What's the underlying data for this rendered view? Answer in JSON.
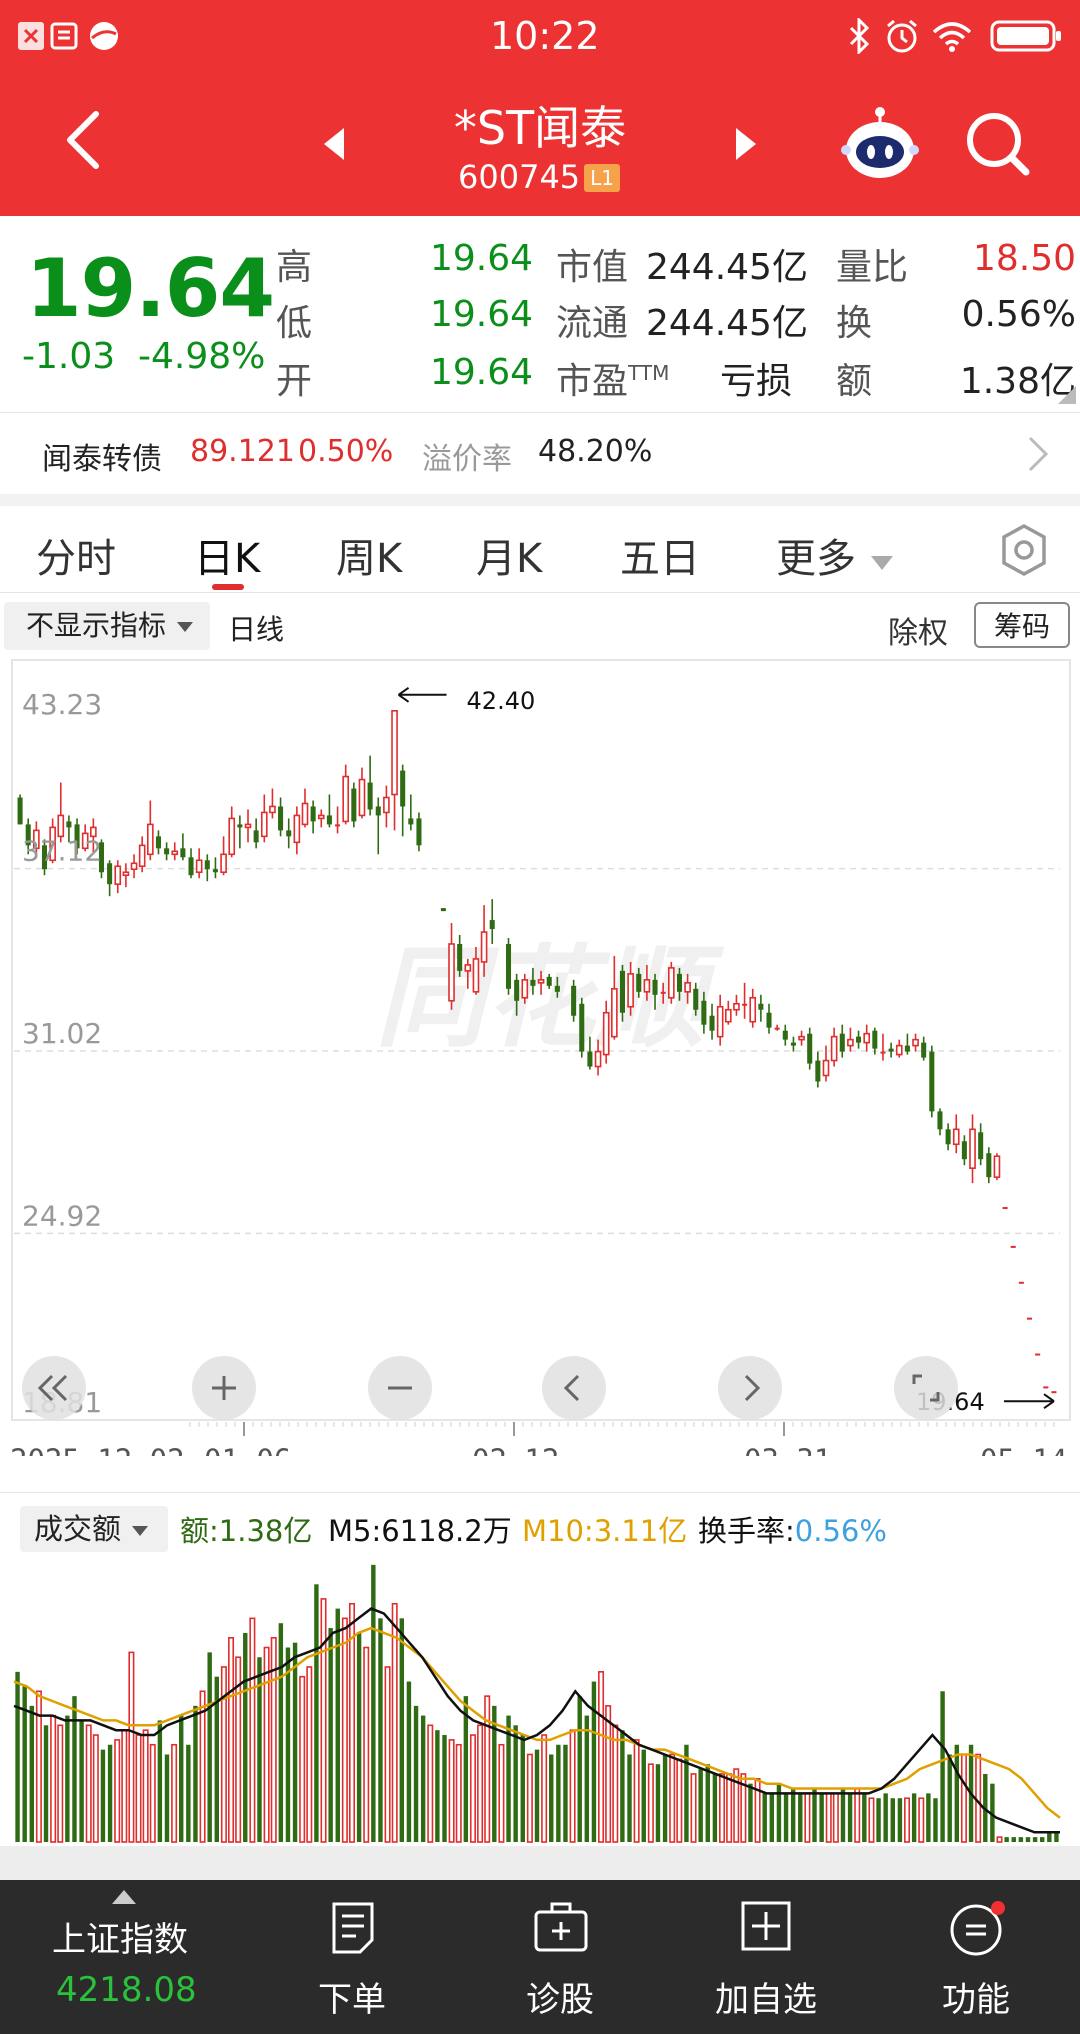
{
  "status": {
    "time": "10:22"
  },
  "header": {
    "title": "*ST闻泰",
    "code": "600745",
    "badge": "L1"
  },
  "quote": {
    "price": "19.64",
    "change": "-1.03",
    "change_pct": "-4.98%",
    "high_label": "高",
    "high": "19.64",
    "low_label": "低",
    "low": "19.64",
    "open_label": "开",
    "open": "19.64",
    "mktcap_label": "市值",
    "mktcap": "244.45亿",
    "float_label": "流通",
    "float": "244.45亿",
    "pe_label": "市盈",
    "pe_sup": "TTM",
    "pe": "亏损",
    "volratio_label": "量比",
    "volratio": "18.50",
    "turnover_label": "换",
    "turnover": "0.56%",
    "amount_label": "额",
    "amount": "1.38亿"
  },
  "bond": {
    "name": "闻泰转债",
    "price": "89.121",
    "pct": "0.50%",
    "premium_label": "溢价率",
    "premium": "48.20%"
  },
  "tabs": [
    {
      "label": "分时"
    },
    {
      "label": "日K"
    },
    {
      "label": "周K"
    },
    {
      "label": "月K"
    },
    {
      "label": "五日"
    },
    {
      "label": "更多"
    }
  ],
  "chart_toolbar": {
    "indicator": "不显示指标",
    "line_type": "日线",
    "exright": "除权",
    "chips": "筹码"
  },
  "colors": {
    "up": "#e02d2d",
    "down": "#2e6b12",
    "ma5": "#111111",
    "ma10": "#e0a000",
    "header": "#ec3232"
  },
  "chart_data": [
    {
      "type": "candlestick",
      "y_ticks": [
        "43.23",
        "37.12",
        "31.02",
        "24.92",
        "18.81"
      ],
      "ylim": [
        18.81,
        43.23
      ],
      "max_annotation": "42.40",
      "last_annotation": "19.64",
      "x_labels": [
        "2025-12-02",
        "01-06",
        "02-12",
        "03-31",
        "05-14"
      ],
      "candles": [
        [
          39.5,
          38.6,
          39.6,
          38.6
        ],
        [
          38.6,
          37.9,
          38.8,
          37.6
        ],
        [
          37.8,
          38.4,
          38.7,
          37.5
        ],
        [
          37.9,
          37.1,
          38.1,
          36.9
        ],
        [
          37.4,
          38.5,
          38.8,
          37.3
        ],
        [
          38.2,
          38.9,
          40.0,
          38.0
        ],
        [
          38.7,
          38.5,
          38.9,
          38.0
        ],
        [
          38.6,
          37.8,
          38.8,
          37.6
        ],
        [
          37.8,
          38.3,
          38.6,
          37.7
        ],
        [
          38.2,
          38.5,
          38.8,
          37.6
        ],
        [
          38.0,
          37.0,
          38.1,
          36.8
        ],
        [
          37.3,
          36.6,
          37.4,
          36.2
        ],
        [
          36.6,
          37.2,
          37.4,
          36.3
        ],
        [
          36.9,
          37.0,
          37.3,
          36.5
        ],
        [
          37.1,
          37.3,
          37.6,
          36.8
        ],
        [
          37.2,
          37.9,
          38.2,
          37.0
        ],
        [
          37.6,
          38.6,
          39.4,
          37.4
        ],
        [
          38.2,
          37.8,
          38.4,
          37.6
        ],
        [
          37.8,
          37.6,
          38.0,
          37.4
        ],
        [
          37.6,
          37.7,
          38.0,
          37.4
        ],
        [
          37.8,
          37.5,
          38.3,
          37.4
        ],
        [
          37.5,
          36.9,
          37.8,
          36.8
        ],
        [
          37.0,
          37.4,
          37.8,
          36.8
        ],
        [
          37.4,
          37.1,
          37.6,
          36.7
        ],
        [
          37.1,
          37.0,
          37.5,
          36.8
        ],
        [
          37.0,
          37.6,
          38.2,
          36.9
        ],
        [
          37.6,
          38.8,
          39.2,
          37.5
        ],
        [
          38.6,
          38.5,
          38.9,
          37.8
        ],
        [
          38.5,
          38.6,
          39.1,
          38.0
        ],
        [
          38.4,
          38.0,
          38.8,
          37.8
        ],
        [
          38.2,
          39.0,
          39.6,
          38.0
        ],
        [
          39.0,
          39.2,
          39.8,
          38.8
        ],
        [
          39.2,
          38.4,
          39.5,
          38.2
        ],
        [
          38.4,
          38.2,
          38.8,
          37.8
        ],
        [
          38.0,
          38.9,
          39.2,
          37.6
        ],
        [
          38.6,
          39.3,
          39.8,
          38.5
        ],
        [
          39.2,
          38.7,
          39.4,
          38.3
        ],
        [
          38.8,
          38.9,
          39.1,
          38.5
        ],
        [
          38.9,
          38.6,
          39.6,
          38.5
        ],
        [
          38.6,
          38.6,
          39.2,
          38.3
        ],
        [
          38.7,
          40.2,
          40.6,
          38.6
        ],
        [
          39.8,
          38.7,
          40.0,
          38.5
        ],
        [
          38.9,
          40.1,
          40.5,
          38.8
        ],
        [
          40.0,
          39.1,
          40.9,
          38.9
        ],
        [
          39.2,
          38.9,
          39.5,
          37.6
        ],
        [
          39.0,
          39.5,
          39.9,
          38.5
        ],
        [
          39.6,
          42.4,
          42.4,
          38.4
        ],
        [
          40.4,
          39.2,
          40.6,
          38.2
        ],
        [
          38.8,
          38.6,
          39.6,
          38.4
        ],
        [
          38.8,
          37.9,
          39.0,
          37.7
        ],
        null,
        null,
        [
          35.8,
          35.7,
          35.8,
          35.7
        ],
        [
          32.7,
          34.6,
          35.3,
          32.4
        ],
        [
          34.6,
          33.7,
          34.9,
          33.5
        ],
        [
          33.7,
          33.9,
          34.1,
          33.1
        ],
        [
          33.0,
          34.1,
          34.5,
          32.9
        ],
        [
          34.0,
          35.0,
          35.9,
          33.5
        ],
        [
          35.4,
          35.1,
          36.1,
          34.6
        ],
        null,
        [
          34.6,
          33.1,
          34.8,
          32.9
        ],
        [
          33.4,
          32.7,
          33.6,
          32.2
        ],
        [
          32.8,
          33.4,
          33.6,
          32.6
        ],
        [
          33.4,
          33.2,
          33.8,
          32.9
        ],
        [
          33.3,
          33.4,
          33.7,
          32.9
        ],
        [
          33.5,
          33.2,
          33.6,
          33.1
        ],
        [
          33.2,
          33.0,
          33.5,
          32.8
        ],
        null,
        [
          33.2,
          32.2,
          33.4,
          32.0
        ],
        [
          32.6,
          31.0,
          32.8,
          30.8
        ],
        [
          31.0,
          30.5,
          31.5,
          30.4
        ],
        [
          30.5,
          31.0,
          31.4,
          30.2
        ],
        [
          30.9,
          32.3,
          32.7,
          30.6
        ],
        [
          31.5,
          33.1,
          34.2,
          31.4
        ],
        [
          33.7,
          32.3,
          33.9,
          32.0
        ],
        [
          32.5,
          33.6,
          34.0,
          32.2
        ],
        [
          33.6,
          33.0,
          33.8,
          32.8
        ],
        [
          33.0,
          33.4,
          33.9,
          32.7
        ],
        [
          33.4,
          32.9,
          33.6,
          32.4
        ],
        [
          33.0,
          33.0,
          33.3,
          32.6
        ],
        [
          32.8,
          33.8,
          34.0,
          32.6
        ],
        [
          33.6,
          33.0,
          33.8,
          32.7
        ],
        [
          33.0,
          33.3,
          33.6,
          32.6
        ],
        [
          33.1,
          32.4,
          33.3,
          32.2
        ],
        [
          32.7,
          31.9,
          33.0,
          31.6
        ],
        [
          32.2,
          31.7,
          32.6,
          31.4
        ],
        [
          31.5,
          32.5,
          32.9,
          31.2
        ],
        [
          32.0,
          32.4,
          32.7,
          31.9
        ],
        [
          32.4,
          32.6,
          32.9,
          32.2
        ],
        [
          32.6,
          32.6,
          33.3,
          32.1
        ],
        [
          32.0,
          32.8,
          33.1,
          31.8
        ],
        [
          32.6,
          32.4,
          32.9,
          32.0
        ],
        [
          32.3,
          31.8,
          32.6,
          31.6
        ],
        [
          31.8,
          31.8,
          31.9,
          31.7
        ],
        [
          31.7,
          31.4,
          31.9,
          31.2
        ],
        [
          31.3,
          31.2,
          31.5,
          31.0
        ],
        [
          31.4,
          31.5,
          31.7,
          31.2
        ],
        [
          31.6,
          30.6,
          31.8,
          30.4
        ],
        [
          30.7,
          30.0,
          31.0,
          29.8
        ],
        [
          30.2,
          30.7,
          31.2,
          30.0
        ],
        [
          30.7,
          31.5,
          31.8,
          30.5
        ],
        [
          31.6,
          31.0,
          31.9,
          30.8
        ],
        [
          31.2,
          31.4,
          31.8,
          31.0
        ],
        [
          31.5,
          31.3,
          31.7,
          31.1
        ],
        [
          31.3,
          31.6,
          31.9,
          31.0
        ],
        [
          31.7,
          31.1,
          31.8,
          30.9
        ],
        [
          31.0,
          31.0,
          31.6,
          30.7
        ],
        [
          31.1,
          31.0,
          31.3,
          30.8
        ],
        [
          30.9,
          31.2,
          31.4,
          30.8
        ],
        [
          31.2,
          31.0,
          31.6,
          30.9
        ],
        [
          31.2,
          31.4,
          31.6,
          31.0
        ],
        [
          31.3,
          30.8,
          31.5,
          30.7
        ],
        [
          31.0,
          29.0,
          31.2,
          28.8
        ],
        [
          29.0,
          28.4,
          29.1,
          28.2
        ],
        [
          28.4,
          27.9,
          28.6,
          27.7
        ],
        [
          27.9,
          28.4,
          28.9,
          27.6
        ],
        [
          28.0,
          27.4,
          28.2,
          27.2
        ],
        [
          27.1,
          28.4,
          28.9,
          26.6
        ],
        [
          28.3,
          27.4,
          28.6,
          27.2
        ],
        [
          27.6,
          26.8,
          27.8,
          26.6
        ],
        [
          26.8,
          27.5,
          27.6,
          26.7
        ],
        [
          25.8,
          25.8,
          25.8,
          25.8
        ],
        [
          24.5,
          24.5,
          24.5,
          24.5
        ],
        [
          23.3,
          23.3,
          23.3,
          23.3
        ],
        [
          22.1,
          22.1,
          22.1,
          22.1
        ],
        [
          20.9,
          20.9,
          20.9,
          20.9
        ],
        [
          19.8,
          19.8,
          19.8,
          19.8
        ],
        [
          19.64,
          19.64,
          19.64,
          19.64
        ]
      ]
    },
    {
      "type": "bar",
      "indicator": "成交额",
      "amount_label": "额:",
      "amount": "1.38亿",
      "m5_label": "M5:",
      "m5": "6118.2万",
      "m10_label": "M10:",
      "m10": "3.11亿",
      "turnover_label": "换手率:",
      "turnover": "0.56%",
      "ylim": [
        0,
        5.8
      ],
      "values": [
        3.5,
        3.2,
        2.8,
        3.1,
        2.4,
        2.6,
        2.4,
        2.6,
        3.0,
        2.5,
        2.4,
        2.2,
        1.9,
        2.0,
        2.1,
        2.3,
        3.9,
        2.2,
        2.3,
        2.0,
        2.5,
        1.8,
        2.0,
        2.6,
        2.0,
        2.8,
        3.1,
        3.9,
        3.4,
        3.6,
        4.2,
        3.8,
        4.3,
        4.6,
        3.8,
        4.0,
        4.2,
        4.5,
        4.0,
        4.1,
        3.4,
        3.6,
        5.3,
        5.0,
        4.4,
        4.8,
        4.6,
        4.9,
        4.3,
        4.0,
        5.7,
        4.6,
        3.6,
        4.9,
        4.6,
        3.3,
        2.8,
        2.6,
        2.4,
        2.3,
        2.2,
        2.1,
        2.0,
        3.0,
        2.2,
        2.4,
        3.0,
        2.8,
        2.0,
        2.6,
        2.4,
        2.2,
        1.8,
        1.9,
        2.2,
        1.8,
        2.0,
        2.0,
        2.3,
        3.0,
        2.6,
        3.3,
        3.5,
        2.8,
        2.4,
        2.3,
        1.8,
        2.1,
        1.9,
        1.6,
        1.6,
        1.8,
        1.8,
        1.7,
        2.0,
        1.4,
        1.5,
        1.6,
        1.4,
        1.4,
        1.4,
        1.5,
        1.4,
        1.2,
        1.3,
        1.0,
        1.0,
        1.2,
        1.0,
        1.1,
        1.0,
        1.0,
        1.1,
        1.0,
        1.0,
        1.0,
        1.1,
        1.0,
        1.1,
        1.0,
        0.9,
        0.9,
        1.0,
        0.9,
        0.9,
        0.9,
        1.0,
        0.9,
        1.0,
        0.9,
        3.1,
        1.8,
        2.0,
        1.8,
        2.0,
        1.8,
        1.4,
        1.2,
        0.1,
        0.1,
        0.1,
        0.1,
        0.1,
        0.1,
        0.1,
        0.2,
        0.2
      ],
      "ma5": [
        2.8,
        2.7,
        2.6,
        2.6,
        2.5,
        2.5,
        2.5,
        2.4,
        2.3,
        2.3,
        2.2,
        2.2,
        2.4,
        2.5,
        2.6,
        2.7,
        2.9,
        3.1,
        3.3,
        3.4,
        3.5,
        3.6,
        3.8,
        3.9,
        4.0,
        4.3,
        4.4,
        4.6,
        4.8,
        4.7,
        4.4,
        4.1,
        3.8,
        3.4,
        3.0,
        2.7,
        2.5,
        2.4,
        2.3,
        2.2,
        2.1,
        2.2,
        2.4,
        2.7,
        3.1,
        2.8,
        2.6,
        2.4,
        2.2,
        2.0,
        1.9,
        1.8,
        1.7,
        1.6,
        1.5,
        1.4,
        1.3,
        1.2,
        1.1,
        1.0,
        1.0,
        1.0,
        1.0,
        1.0,
        1.0,
        1.0,
        1.0,
        1.0,
        1.1,
        1.3,
        1.6,
        1.9,
        2.2,
        1.9,
        1.4,
        1.0,
        0.7,
        0.5,
        0.4,
        0.3,
        0.2,
        0.2,
        0.2
      ],
      "ma10": [
        3.3,
        3.2,
        3.0,
        2.9,
        2.8,
        2.7,
        2.6,
        2.5,
        2.5,
        2.4,
        2.4,
        2.4,
        2.5,
        2.6,
        2.7,
        2.8,
        2.9,
        3.0,
        3.1,
        3.2,
        3.3,
        3.4,
        3.6,
        3.8,
        3.9,
        4.0,
        4.1,
        4.3,
        4.4,
        4.3,
        4.2,
        4.0,
        3.8,
        3.5,
        3.2,
        2.9,
        2.7,
        2.5,
        2.4,
        2.3,
        2.2,
        2.1,
        2.1,
        2.2,
        2.3,
        2.3,
        2.2,
        2.1,
        2.1,
        2.0,
        1.9,
        1.9,
        1.8,
        1.7,
        1.6,
        1.5,
        1.4,
        1.3,
        1.3,
        1.2,
        1.2,
        1.1,
        1.1,
        1.1,
        1.1,
        1.1,
        1.1,
        1.1,
        1.1,
        1.2,
        1.3,
        1.5,
        1.6,
        1.7,
        1.8,
        1.8,
        1.7,
        1.6,
        1.5,
        1.3,
        1.0,
        0.7,
        0.5
      ]
    }
  ],
  "bottom_nav": {
    "index_name": "上证指数",
    "index_value": "4218.08",
    "items": [
      {
        "label": "下单"
      },
      {
        "label": "诊股"
      },
      {
        "label": "加自选"
      },
      {
        "label": "功能"
      }
    ]
  },
  "watermark": "同花顺"
}
